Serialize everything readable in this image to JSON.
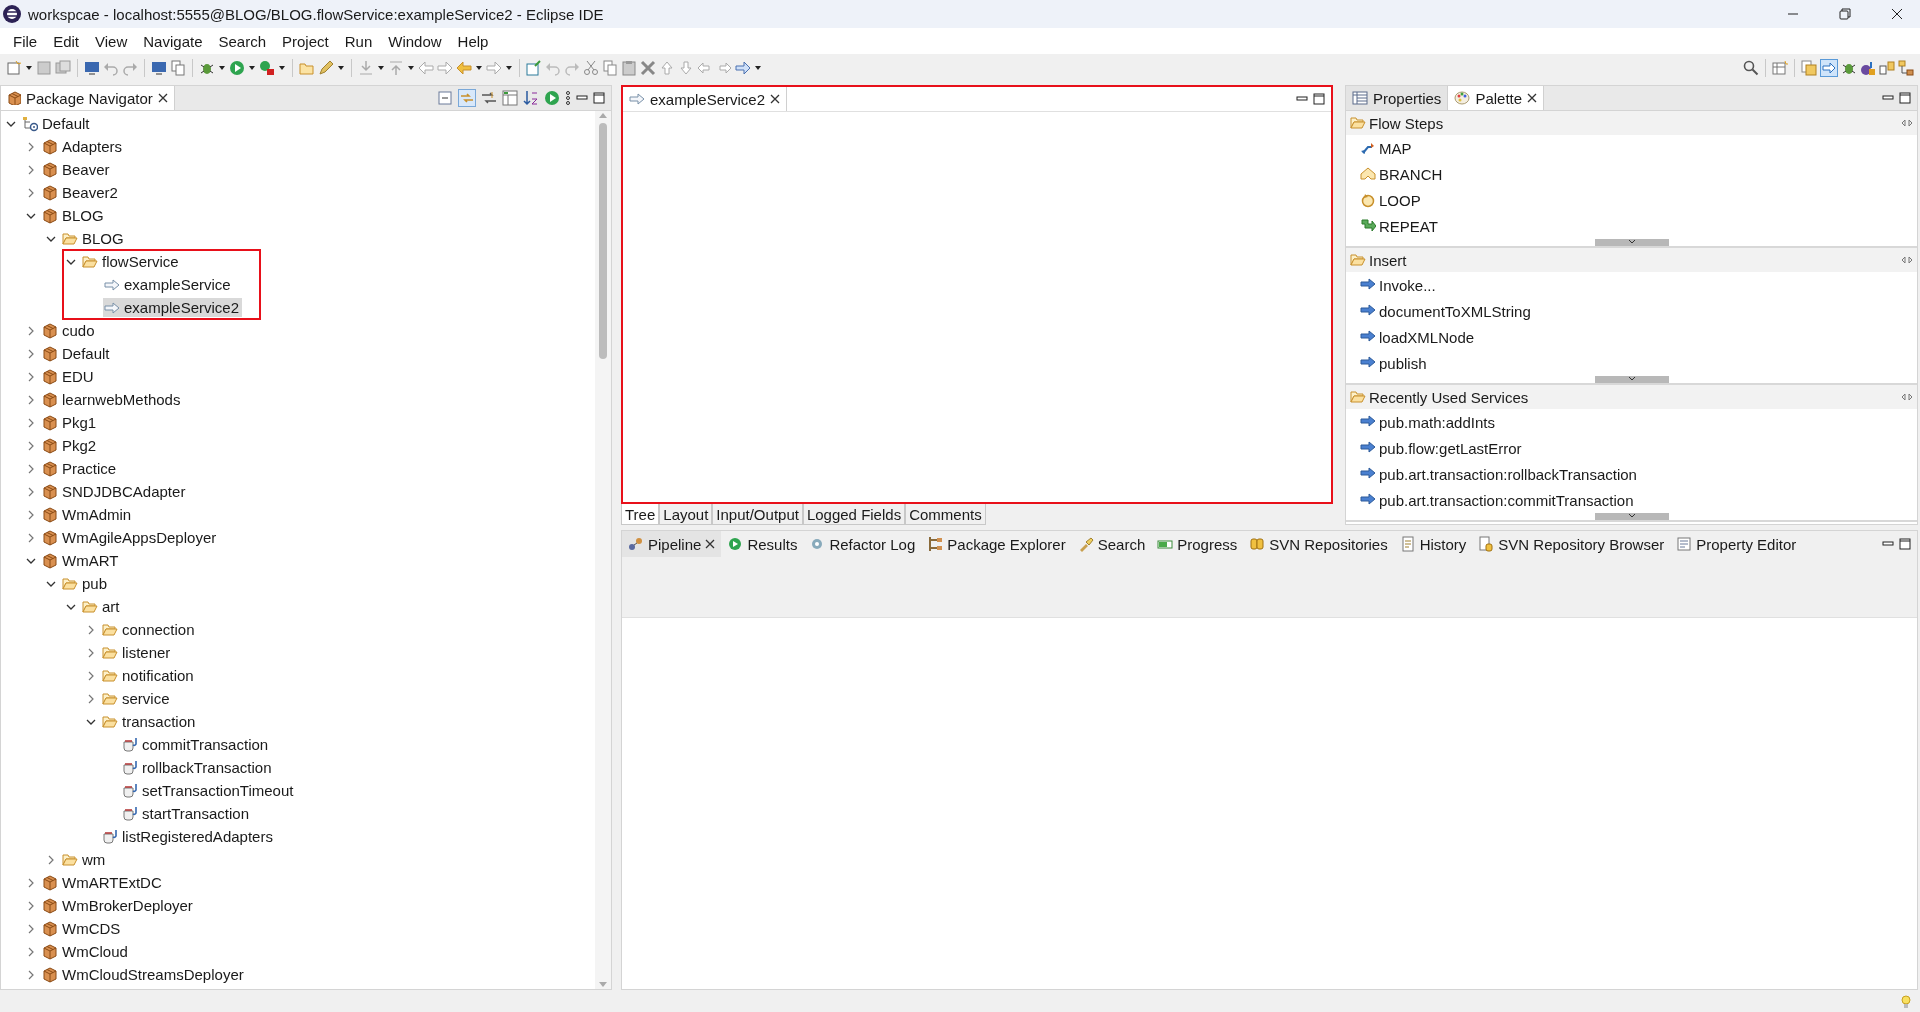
{
  "window": {
    "title": "workspcae - localhost:5555@BLOG/BLOG.flowService:exampleService2 - Eclipse IDE"
  },
  "menu": [
    {
      "label": "File"
    },
    {
      "label": "Edit"
    },
    {
      "label": "View"
    },
    {
      "label": "Navigate"
    },
    {
      "label": "Search"
    },
    {
      "label": "Project"
    },
    {
      "label": "Run"
    },
    {
      "label": "Window"
    },
    {
      "label": "Help"
    }
  ],
  "navigator": {
    "tab": {
      "label": "Package Navigator",
      "selected": true
    },
    "tree": [
      {
        "label": "Default",
        "kind": "server",
        "expanded": true,
        "selected": false,
        "highlighted": false,
        "children": [
          {
            "label": "Adapters",
            "kind": "package",
            "expanded": false,
            "selected": false,
            "highlighted": false
          },
          {
            "label": "Beaver",
            "kind": "package",
            "expanded": false,
            "selected": false,
            "highlighted": false
          },
          {
            "label": "Beaver2",
            "kind": "package",
            "expanded": false,
            "selected": false,
            "highlighted": false
          },
          {
            "label": "BLOG",
            "kind": "package",
            "expanded": true,
            "selected": false,
            "highlighted": false,
            "children": [
              {
                "label": "BLOG",
                "kind": "folder",
                "expanded": true,
                "selected": false,
                "highlighted": false,
                "children": [
                  {
                    "label": "flowService",
                    "kind": "folder",
                    "expanded": true,
                    "selected": false,
                    "highlighted": true,
                    "children": [
                      {
                        "label": "exampleService",
                        "kind": "flow",
                        "selected": false,
                        "highlighted": false
                      },
                      {
                        "label": "exampleService2",
                        "kind": "flow",
                        "selected": true,
                        "highlighted": false
                      }
                    ]
                  }
                ]
              }
            ]
          },
          {
            "label": "cudo",
            "kind": "package",
            "expanded": false,
            "selected": false,
            "highlighted": false
          },
          {
            "label": "Default",
            "kind": "package",
            "expanded": false,
            "selected": false,
            "highlighted": false
          },
          {
            "label": "EDU",
            "kind": "package",
            "expanded": false,
            "selected": false,
            "highlighted": false
          },
          {
            "label": "learnwebMethods",
            "kind": "package",
            "expanded": false,
            "selected": false,
            "highlighted": false
          },
          {
            "label": "Pkg1",
            "kind": "package",
            "expanded": false,
            "selected": false,
            "highlighted": false
          },
          {
            "label": "Pkg2",
            "kind": "package",
            "expanded": false,
            "selected": false,
            "highlighted": false
          },
          {
            "label": "Practice",
            "kind": "package",
            "expanded": false,
            "selected": false,
            "highlighted": false
          },
          {
            "label": "SNDJDBCAdapter",
            "kind": "package",
            "expanded": false,
            "selected": false,
            "highlighted": false
          },
          {
            "label": "WmAdmin",
            "kind": "package",
            "expanded": false,
            "selected": false,
            "highlighted": false
          },
          {
            "label": "WmAgileAppsDeployer",
            "kind": "package",
            "expanded": false,
            "selected": false,
            "highlighted": false
          },
          {
            "label": "WmART",
            "kind": "package",
            "expanded": true,
            "selected": false,
            "highlighted": false,
            "children": [
              {
                "label": "pub",
                "kind": "folder",
                "expanded": true,
                "selected": false,
                "highlighted": false,
                "children": [
                  {
                    "label": "art",
                    "kind": "folder",
                    "expanded": true,
                    "selected": false,
                    "highlighted": false,
                    "children": [
                      {
                        "label": "connection",
                        "kind": "folder",
                        "expanded": false,
                        "selected": false,
                        "highlighted": false
                      },
                      {
                        "label": "listener",
                        "kind": "folder",
                        "expanded": false,
                        "selected": false,
                        "highlighted": false
                      },
                      {
                        "label": "notification",
                        "kind": "folder",
                        "expanded": false,
                        "selected": false,
                        "highlighted": false
                      },
                      {
                        "label": "service",
                        "kind": "folder",
                        "expanded": false,
                        "selected": false,
                        "highlighted": false
                      },
                      {
                        "label": "transaction",
                        "kind": "folder",
                        "expanded": true,
                        "selected": false,
                        "highlighted": false,
                        "children": [
                          {
                            "label": "commitTransaction",
                            "kind": "java",
                            "selected": false,
                            "highlighted": false
                          },
                          {
                            "label": "rollbackTransaction",
                            "kind": "java",
                            "selected": false,
                            "highlighted": false
                          },
                          {
                            "label": "setTransactionTimeout",
                            "kind": "java",
                            "selected": false,
                            "highlighted": false
                          },
                          {
                            "label": "startTransaction",
                            "kind": "java",
                            "selected": false,
                            "highlighted": false
                          }
                        ]
                      },
                      {
                        "label": "listRegisteredAdapters",
                        "kind": "java",
                        "selected": false,
                        "highlighted": false
                      }
                    ]
                  }
                ]
              },
              {
                "label": "wm",
                "kind": "folder",
                "expanded": false,
                "selected": false,
                "highlighted": false
              }
            ]
          },
          {
            "label": "WmARTExtDC",
            "kind": "package",
            "expanded": false,
            "selected": false,
            "highlighted": false
          },
          {
            "label": "WmBrokerDeployer",
            "kind": "package",
            "expanded": false,
            "selected": false,
            "highlighted": false
          },
          {
            "label": "WmCDS",
            "kind": "package",
            "expanded": false,
            "selected": false,
            "highlighted": false
          },
          {
            "label": "WmCloud",
            "kind": "package",
            "expanded": false,
            "selected": false,
            "highlighted": false
          },
          {
            "label": "WmCloudStreamsDeployer",
            "kind": "package",
            "expanded": false,
            "selected": false,
            "highlighted": false
          }
        ]
      }
    ]
  },
  "editor": {
    "tab": {
      "label": "exampleService2",
      "selected": true
    },
    "highlighted": true,
    "bottom_tabs": [
      {
        "label": "Tree",
        "selected": true
      },
      {
        "label": "Layout",
        "selected": false
      },
      {
        "label": "Input/Output",
        "selected": false
      },
      {
        "label": "Logged Fields",
        "selected": false
      },
      {
        "label": "Comments",
        "selected": false
      }
    ]
  },
  "side_panel": {
    "tabs": [
      {
        "label": "Properties",
        "kind": "properties",
        "selected": false
      },
      {
        "label": "Palette",
        "kind": "palette",
        "selected": true
      }
    ],
    "drawers": [
      {
        "title": "Flow Steps",
        "items": [
          {
            "label": "MAP",
            "kind": "map"
          },
          {
            "label": "BRANCH",
            "kind": "branch"
          },
          {
            "label": "LOOP",
            "kind": "loop"
          },
          {
            "label": "REPEAT",
            "kind": "repeat"
          }
        ]
      },
      {
        "title": "Insert",
        "items": [
          {
            "label": "Invoke...",
            "kind": "service"
          },
          {
            "label": "documentToXMLString",
            "kind": "service"
          },
          {
            "label": "loadXMLNode",
            "kind": "service"
          },
          {
            "label": "publish",
            "kind": "service"
          }
        ]
      },
      {
        "title": "Recently Used Services",
        "items": [
          {
            "label": "pub.math:addInts",
            "kind": "service"
          },
          {
            "label": "pub.flow:getLastError",
            "kind": "service"
          },
          {
            "label": "pub.art.transaction:rollbackTransaction",
            "kind": "service"
          },
          {
            "label": "pub.art.transaction:commitTransaction",
            "kind": "service"
          }
        ]
      }
    ]
  },
  "bottom_panel": {
    "tabs": [
      {
        "label": "Pipeline",
        "kind": "pipeline",
        "selected": true
      },
      {
        "label": "Results",
        "kind": "results",
        "selected": false
      },
      {
        "label": "Refactor Log",
        "kind": "refactor",
        "selected": false
      },
      {
        "label": "Package Explorer",
        "kind": "explorer",
        "selected": false
      },
      {
        "label": "Search",
        "kind": "search",
        "selected": false
      },
      {
        "label": "Progress",
        "kind": "progress",
        "selected": false
      },
      {
        "label": "SVN Repositories",
        "kind": "svn",
        "selected": false
      },
      {
        "label": "History",
        "kind": "history",
        "selected": false
      },
      {
        "label": "SVN Repository Browser",
        "kind": "svnbrowser",
        "selected": false
      },
      {
        "label": "Property Editor",
        "kind": "propeditor",
        "selected": false
      }
    ]
  }
}
